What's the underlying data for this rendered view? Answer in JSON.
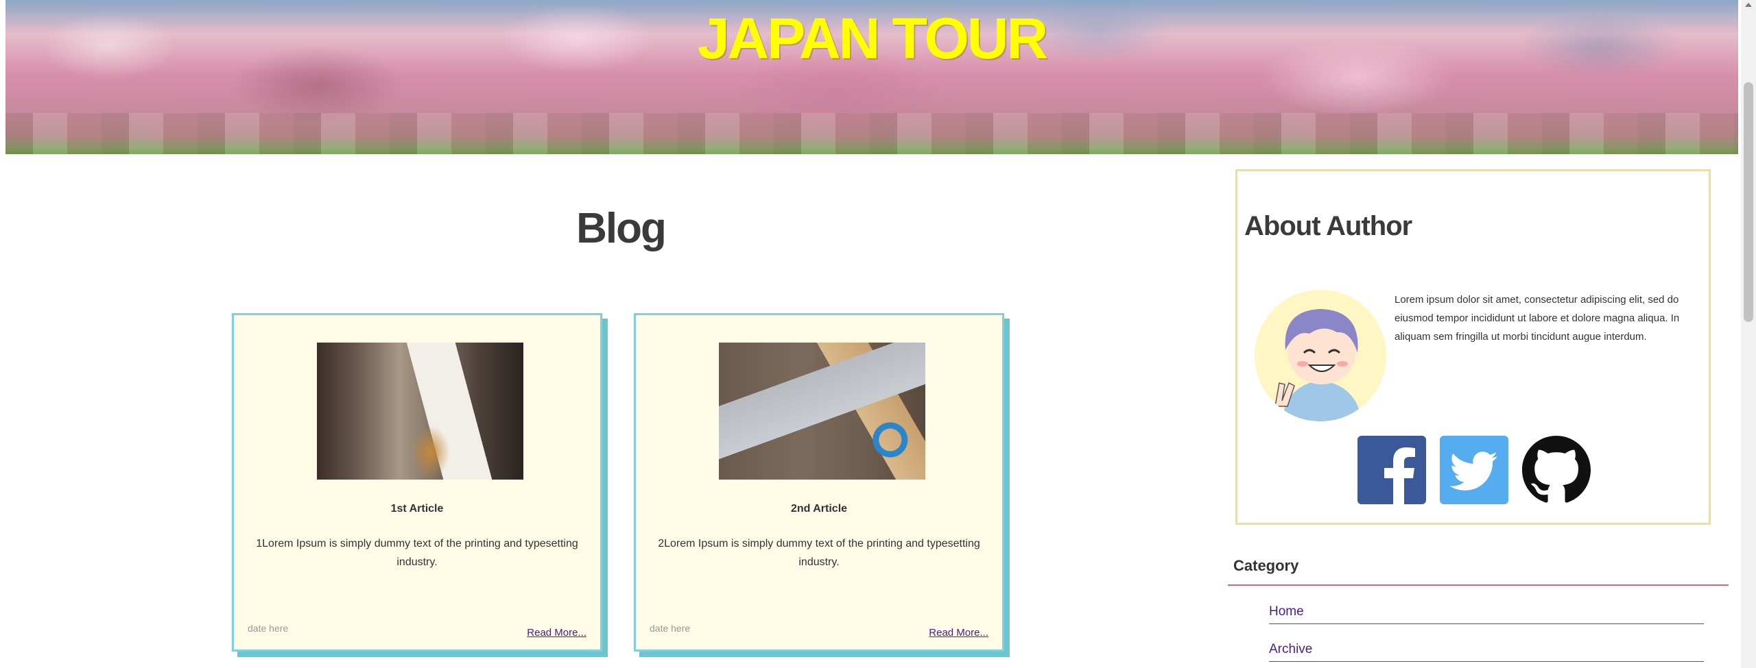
{
  "hero": {
    "title": "JAPAN TOUR"
  },
  "blog": {
    "title": "Blog",
    "articles": [
      {
        "heading": "1st Article",
        "text": "1Lorem Ipsum is simply dummy text of the printing and typesetting industry.",
        "date": "date here",
        "read_more": "Read More..."
      },
      {
        "heading": "2nd Article",
        "text": "2Lorem Ipsum is simply dummy text of the printing and typesetting industry.",
        "date": "date here",
        "read_more": "Read More..."
      }
    ]
  },
  "sidebar": {
    "about": {
      "title": "About Author",
      "text": "Lorem ipsum dolor sit amet, consectetur adipiscing elit, sed do eiusmod tempor incididunt ut labore et dolore magna aliqua. In aliquam sem fringilla ut morbi tincidunt augue interdum.",
      "social": [
        "facebook-icon",
        "twitter-icon",
        "github-icon"
      ]
    },
    "category": {
      "title": "Category",
      "items": [
        "Home",
        "Archive"
      ]
    }
  },
  "colors": {
    "title_yellow": "#ffff00",
    "card_bg": "#fefbe6",
    "card_border": "#7fd0dc",
    "about_border": "#f0e08a",
    "category_rule": "#e0607a",
    "link": "#4b1b8a",
    "facebook": "#3b5998",
    "twitter": "#55acee"
  }
}
